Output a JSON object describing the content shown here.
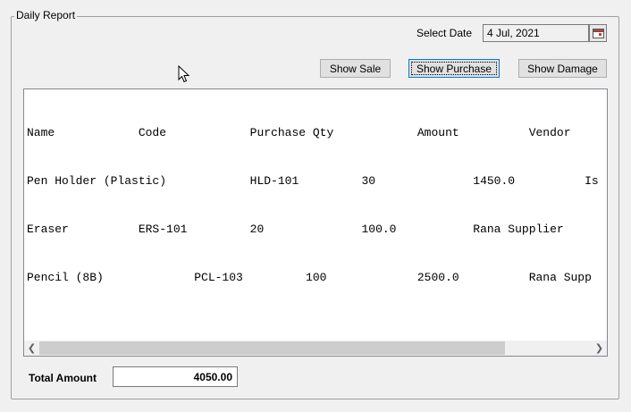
{
  "panel": {
    "title": "Daily Report"
  },
  "date": {
    "label": "Select Date",
    "value": "4 Jul, 2021"
  },
  "buttons": {
    "show_sale": "Show Sale",
    "show_purchase": "Show Purchase",
    "show_damage": "Show Damage"
  },
  "table": {
    "rows": [
      "Name            Code            Purchase Qty            Amount          Vendor",
      "Pen Holder (Plastic)            HLD-101         30              1450.0          Is",
      "Eraser          ERS-101         20              100.0           Rana Supplier",
      "Pencil (8B)             PCL-103         100             2500.0          Rana Supp"
    ]
  },
  "total": {
    "label": "Total Amount",
    "value": "4050.00"
  }
}
